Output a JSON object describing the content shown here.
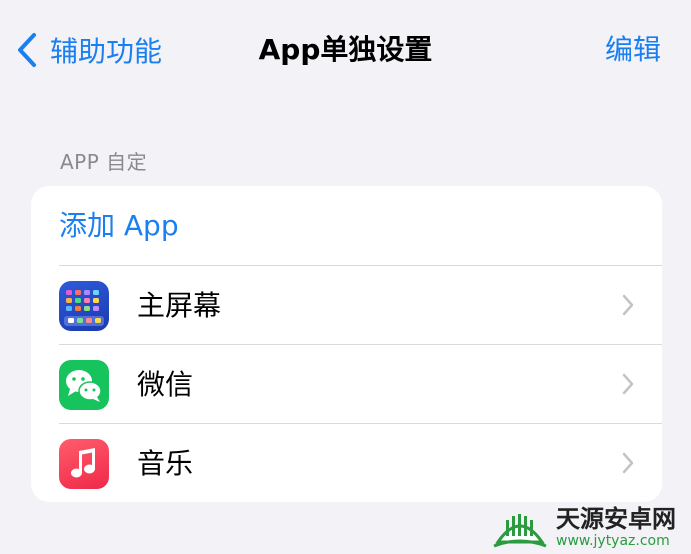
{
  "nav": {
    "back_label": "辅助功能",
    "title": "App单独设置",
    "edit_label": "编辑"
  },
  "section": {
    "header": "APP 自定",
    "add_label": "添加 App",
    "apps": [
      {
        "label": "主屏幕",
        "icon": "home-screen-icon"
      },
      {
        "label": "微信",
        "icon": "wechat-icon"
      },
      {
        "label": "音乐",
        "icon": "music-icon"
      }
    ]
  },
  "colors": {
    "accent": "#1a7ff0",
    "background": "#f2f2f7",
    "secondary_text": "#8a8a8e"
  },
  "watermark": {
    "name": "天源安卓网",
    "url": "www.jytyaz.com"
  }
}
